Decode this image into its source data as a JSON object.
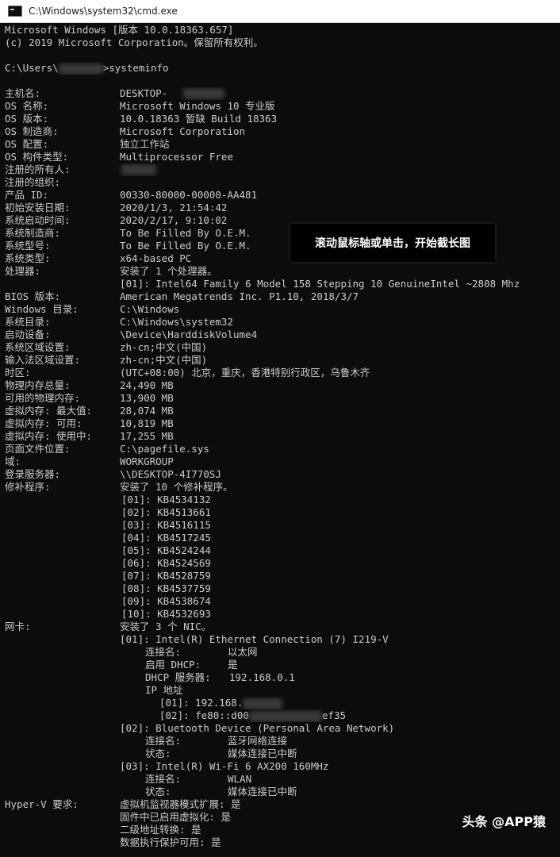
{
  "window": {
    "title": "C:\\Windows\\system32\\cmd.exe",
    "background": "#0c0c0c",
    "foreground": "#cccccc"
  },
  "header": {
    "version_line": "Microsoft Windows [版本 10.0.18363.657]",
    "copyright_line": "(c) 2019 Microsoft Corporation。保留所有权利。",
    "prompt_prefix": "C:\\Users\\",
    "prompt_suffix": ">systeminfo"
  },
  "info": [
    {
      "label": "主机名:",
      "value": "DESKTOP-"
    },
    {
      "label": "OS 名称:",
      "value": "Microsoft Windows 10 专业版"
    },
    {
      "label": "OS 版本:",
      "value": "10.0.18363 暂缺 Build 18363"
    },
    {
      "label": "OS 制造商:",
      "value": "Microsoft Corporation"
    },
    {
      "label": "OS 配置:",
      "value": "独立工作站"
    },
    {
      "label": "OS 构件类型:",
      "value": "Multiprocessor Free"
    },
    {
      "label": "注册的所有人:",
      "value": ""
    },
    {
      "label": "注册的组织:",
      "value": ""
    },
    {
      "label": "产品 ID:",
      "value": "00330-80000-00000-AA481"
    },
    {
      "label": "初始安装日期:",
      "value": "2020/1/3, 21:54:42"
    },
    {
      "label": "系统启动时间:",
      "value": "2020/2/17, 9:10:02"
    },
    {
      "label": "系统制造商:",
      "value": "To Be Filled By O.E.M."
    },
    {
      "label": "系统型号:",
      "value": "To Be Filled By O.E.M."
    },
    {
      "label": "系统类型:",
      "value": "x64-based PC"
    },
    {
      "label": "处理器:",
      "value": "安装了 1 个处理器。"
    },
    {
      "label": "",
      "value": "[01]: Intel64 Family 6 Model 158 Stepping 10 GenuineIntel ~2808 Mhz"
    },
    {
      "label": "BIOS 版本:",
      "value": "American Megatrends Inc. P1.10, 2018/3/7"
    },
    {
      "label": "Windows 目录:",
      "value": "C:\\Windows"
    },
    {
      "label": "系统目录:",
      "value": "C:\\Windows\\system32"
    },
    {
      "label": "启动设备:",
      "value": "\\Device\\HarddiskVolume4"
    },
    {
      "label": "系统区域设置:",
      "value": "zh-cn;中文(中国)"
    },
    {
      "label": "输入法区域设置:",
      "value": "zh-cn;中文(中国)"
    },
    {
      "label": "时区:",
      "value": "(UTC+08:00) 北京，重庆，香港特别行政区，乌鲁木齐"
    },
    {
      "label": "物理内存总量:",
      "value": "24,490 MB"
    },
    {
      "label": "可用的物理内存:",
      "value": "13,900 MB"
    },
    {
      "label": "虚拟内存: 最大值:",
      "value": "28,074 MB"
    },
    {
      "label": "虚拟内存: 可用:",
      "value": "10,819 MB"
    },
    {
      "label": "虚拟内存: 使用中:",
      "value": "17,255 MB"
    },
    {
      "label": "页面文件位置:",
      "value": "C:\\pagefile.sys"
    },
    {
      "label": "域:",
      "value": "WORKGROUP"
    },
    {
      "label": "登录服务器:",
      "value": "\\\\DESKTOP-4I770SJ"
    },
    {
      "label": "修补程序:",
      "value": "安装了 10 个修补程序。"
    }
  ],
  "hotfixes": [
    "[01]: KB4534132",
    "[02]: KB4513661",
    "[03]: KB4516115",
    "[04]: KB4517245",
    "[05]: KB4524244",
    "[06]: KB4524569",
    "[07]: KB4528759",
    "[08]: KB4537759",
    "[09]: KB4538674",
    "[10]: KB4532693"
  ],
  "nic": {
    "label": "网卡:",
    "summary": "安装了 3 个 NIC。",
    "nic1": "[01]: Intel(R) Ethernet Connection (7) I219-V",
    "nic1_conn_label": "连接名:",
    "nic1_conn_value": "以太网",
    "nic1_dhcp_label": "启用 DHCP:",
    "nic1_dhcp_value": "是",
    "nic1_dhcp_server_label": "DHCP 服务器:",
    "nic1_dhcp_server_value": "192.168.0.1",
    "nic1_ip_label": "IP 地址",
    "nic1_ip1": "[01]: 192.168.",
    "nic1_ip2_prefix": "[02]: fe80::d00",
    "nic1_ip2_suffix": "ef35",
    "nic2": "[02]: Bluetooth Device (Personal Area Network)",
    "nic2_conn_label": "连接名:",
    "nic2_conn_value": "蓝牙网络连接",
    "nic2_state_label": "状态:",
    "nic2_state_value": "媒体连接已中断",
    "nic3": "[03]: Intel(R) Wi-Fi 6 AX200 160MHz",
    "nic3_conn_label": "连接名:",
    "nic3_conn_value": "WLAN",
    "nic3_state_label": "状态:",
    "nic3_state_value": "媒体连接已中断"
  },
  "hyperv": {
    "label": "Hyper-V 要求:",
    "line1": "虚拟机监视器模式扩展: 是",
    "line2": "固件中已启用虚拟化: 是",
    "line3": "二级地址转换: 是",
    "line4": "数据执行保护可用: 是"
  },
  "tooltip": "滚动鼠标轴或单击，开始截长图",
  "watermark": "头条 @APP猿"
}
